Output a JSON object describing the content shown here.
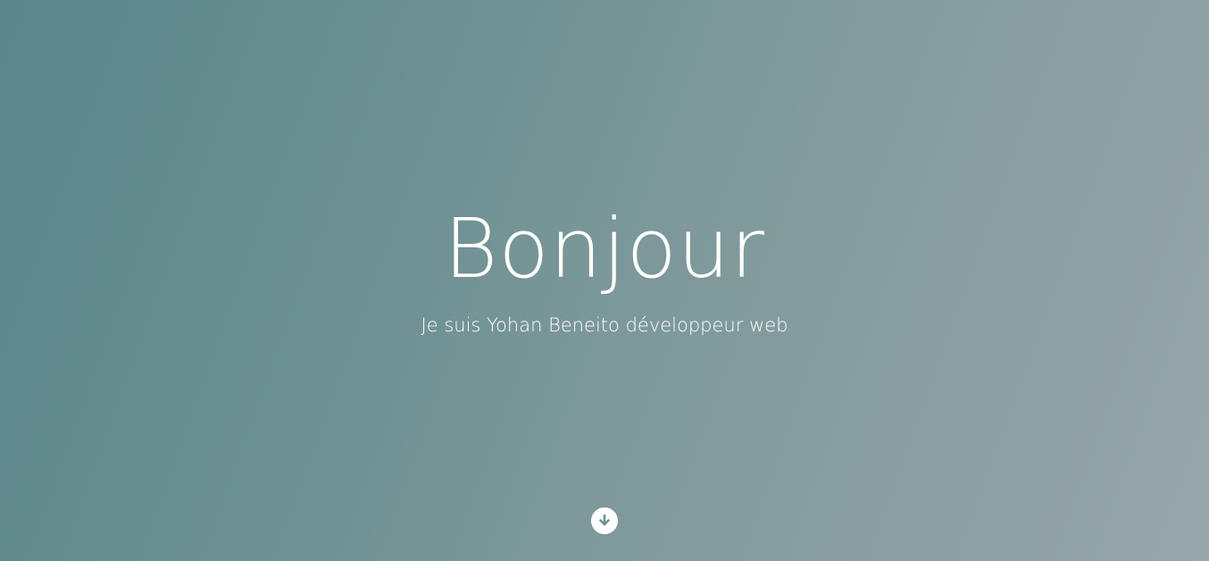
{
  "hero": {
    "title": "Bonjour",
    "subtitle": "Je suis Yohan Beneito développeur web",
    "scroll_icon": "arrow-down-circle-icon"
  },
  "colors": {
    "gradient_start": "#5a878b",
    "gradient_end": "#97a6a8",
    "text": "#ffffff",
    "icon_arrow": "#6f9193"
  }
}
